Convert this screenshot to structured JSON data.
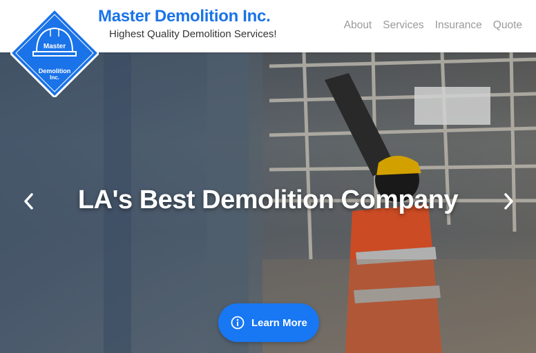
{
  "header": {
    "brand_title": "Master Demolition Inc.",
    "tagline": "Highest Quality Demolition Services!",
    "nav": [
      {
        "label": "About"
      },
      {
        "label": "Services"
      },
      {
        "label": "Insurance"
      },
      {
        "label": "Quote"
      }
    ]
  },
  "logo": {
    "line1": "Master",
    "line2": "Demolition",
    "line3": "Inc."
  },
  "hero": {
    "headline": "LA's Best Demolition Company",
    "cta_label": "Learn More"
  },
  "icons": {
    "prev": "chevron-left-icon",
    "next": "chevron-right-icon",
    "cta": "info-circle-icon",
    "logo": "hard-hat-icon"
  },
  "colors": {
    "brand_blue": "#1a73e8",
    "cta_blue": "#1877f2",
    "nav_gray": "#9a9a9a"
  }
}
